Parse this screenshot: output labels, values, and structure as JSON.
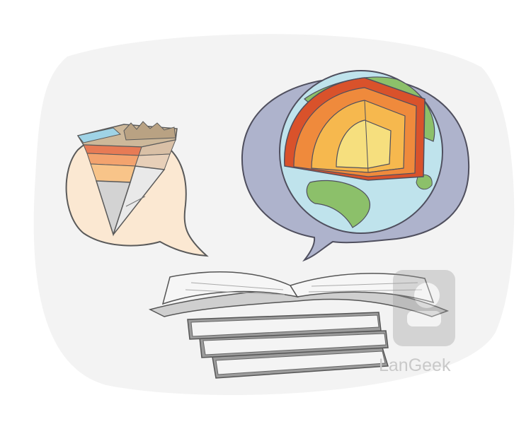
{
  "watermark": {
    "brand": "LanGeek"
  },
  "colors": {
    "backdrop": "#f3f3f3",
    "bubble_left": "#fbe8d2",
    "bubble_right": "#aeb3cc",
    "ocean": "#bfe3ec",
    "land": "#8cc06a",
    "crust": "#d9522b",
    "mantle": "#ef8a3c",
    "outer_core": "#f6b84e",
    "inner_core": "#f6df7e",
    "book_pages": "#f4f4f4",
    "book_cover": "#9c9c9c",
    "outline": "#555555"
  }
}
